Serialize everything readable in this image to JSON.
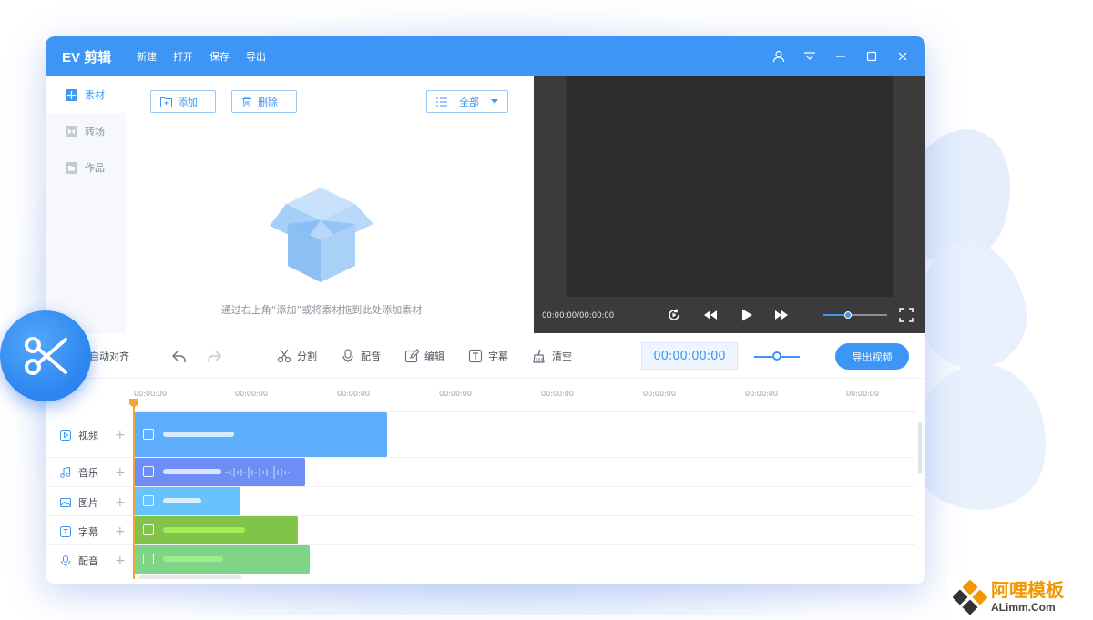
{
  "titlebar": {
    "app_title": "EV 剪辑",
    "menu": [
      "新建",
      "打开",
      "保存",
      "导出"
    ]
  },
  "sidebar": {
    "items": [
      {
        "label": "素材",
        "active": true
      },
      {
        "label": "转场",
        "active": false
      },
      {
        "label": "作品",
        "active": false
      }
    ]
  },
  "material": {
    "add_label": "添加",
    "delete_label": "删除",
    "filter_label": "全部",
    "empty_text": "通过右上角“添加”或将素材拖到此处添加素材"
  },
  "preview": {
    "timecode": "00:00:00/00:00:00",
    "volume_level": 0.38
  },
  "toolbar": {
    "auto_align": "自动对齐",
    "split": "分割",
    "dub": "配音",
    "edit": "编辑",
    "subtitle": "字幕",
    "clear": "清空",
    "current_time": "00:00:00:00",
    "export_label": "导出视频"
  },
  "timeline": {
    "ticks": [
      "00:00:00",
      "00:00:00",
      "00:00:00",
      "00:00:00",
      "00:00:00",
      "00:00:00",
      "00:00:00",
      "00:00:00"
    ],
    "tracks": [
      {
        "label": "视频",
        "icon": "video-icon"
      },
      {
        "label": "音乐",
        "icon": "music-icon"
      },
      {
        "label": "图片",
        "icon": "image-icon"
      },
      {
        "label": "字幕",
        "icon": "subtitle-icon"
      },
      {
        "label": "配音",
        "icon": "mic-icon"
      }
    ]
  },
  "watermark": {
    "main": "阿哩模板",
    "sub": "ALimm.Com"
  },
  "colors": {
    "accent": "#3d96f5",
    "video_clip": "#5faefb",
    "music_clip": "#6f8ef5",
    "image_clip": "#67c3fb",
    "subtitle_clip": "#82c449",
    "dub_clip": "#7fd487",
    "playhead": "#f0a43a"
  }
}
